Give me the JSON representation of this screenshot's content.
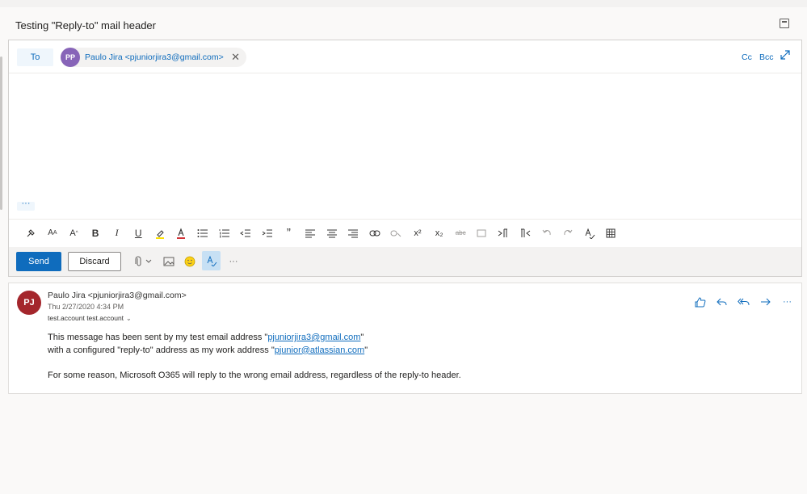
{
  "subject": "Testing \"Reply-to\" mail header",
  "to_row": {
    "to_label": "To",
    "recipient_initials": "PP",
    "recipient": "Paulo Jira <pjuniorjira3@gmail.com>",
    "cc_label": "Cc",
    "bcc_label": "Bcc"
  },
  "compose_ellipsis": "···",
  "format_toolbar": {
    "bold": "B",
    "italic": "I",
    "underline": "U",
    "quote": "”",
    "superscript": "x²",
    "subscript": "x₂",
    "strikethrough": "abc"
  },
  "actions": {
    "send_label": "Send",
    "discard_label": "Discard",
    "more": "···"
  },
  "message": {
    "sender_initials": "PJ",
    "sender": "Paulo Jira <pjuniorjira3@gmail.com>",
    "date": "Thu 2/27/2020 4:34 PM",
    "recipients": "test.account test.account",
    "body_line1_prefix": "This message has been sent by my test email address \"",
    "body_line1_link": "pjuniorjira3@gmail.com",
    "body_line1_suffix": "\"",
    "body_line2_prefix": "with a configured \"reply-to\" address as my work address \"",
    "body_line2_link": "pjunior@atlassian.com",
    "body_line2_suffix": "\"",
    "body_line3": "For some reason, Microsoft O365 will reply to the wrong email address, regardless of the reply-to header.",
    "more": "···"
  },
  "colors": {
    "accent": "#0f6cbd",
    "recipient_avatar": "#8764b8",
    "sender_avatar": "#a4262c"
  }
}
